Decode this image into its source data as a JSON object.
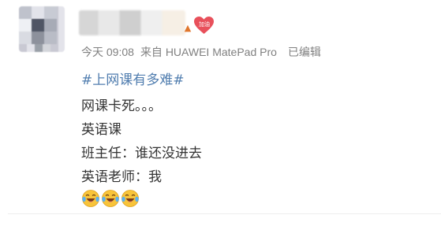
{
  "post": {
    "meta": {
      "time": "今天 09:08",
      "source": "来自 HUAWEI MatePad Pro",
      "edited": "已编辑"
    },
    "badge_label": "加油",
    "topic": "#上网课有多难#",
    "lines": [
      "网课卡死。。。",
      "英语课",
      "班主任：谁还没进去",
      "英语老师：我"
    ],
    "emojis": [
      "laugh-cry-icon",
      "laugh-cry-icon",
      "laugh-cry-icon"
    ]
  },
  "colors": {
    "topic": "#507daf",
    "meta": "#808080",
    "text": "#333333",
    "heart": "#e8505b",
    "badge": "#e0762c"
  }
}
